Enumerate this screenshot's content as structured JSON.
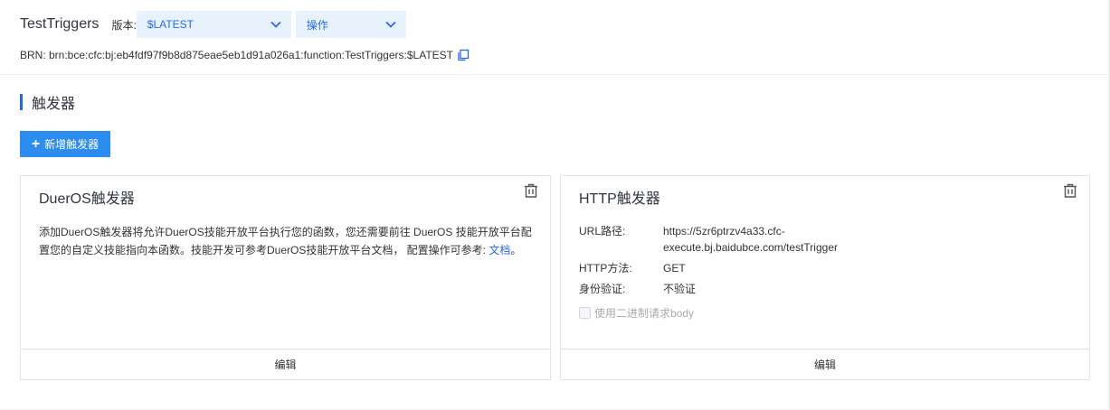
{
  "header": {
    "function_name": "TestTriggers",
    "version_label": "版本:",
    "version_value": "$LATEST",
    "ops_value": "操作"
  },
  "brn": {
    "text": "BRN:  brn:bce:cfc:bj:eb4fdf97f9b8d875eae5eb1d91a026a1:function:TestTriggers:$LATEST"
  },
  "section": {
    "title": "触发器",
    "add_button": "新增触发器"
  },
  "cards": {
    "dueros": {
      "title": "DuerOS触发器",
      "desc_text": "添加DuerOS触发器将允许DuerOS技能开放平台执行您的函数，您还需要前往 DuerOS 技能开放平台配置您的自定义技能指向本函数。技能开发可参考DuerOS技能开放平台文档， 配置操作可参考: ",
      "desc_link": "文档",
      "desc_end": "。",
      "edit": "编辑"
    },
    "http": {
      "title": "HTTP触发器",
      "url_label": "URL路径:",
      "url_value": "https://5zr6ptrzv4a33.cfc-execute.bj.baidubce.com/testTrigger",
      "method_label": "HTTP方法:",
      "method_value": "GET",
      "auth_label": "身份验证:",
      "auth_value": "不验证",
      "binary_label": "使用二进制请求body",
      "edit": "编辑"
    }
  },
  "colors": {
    "accent": "#2468f2",
    "button": "#2d8cf0",
    "select_bg": "#e8f2fd"
  }
}
